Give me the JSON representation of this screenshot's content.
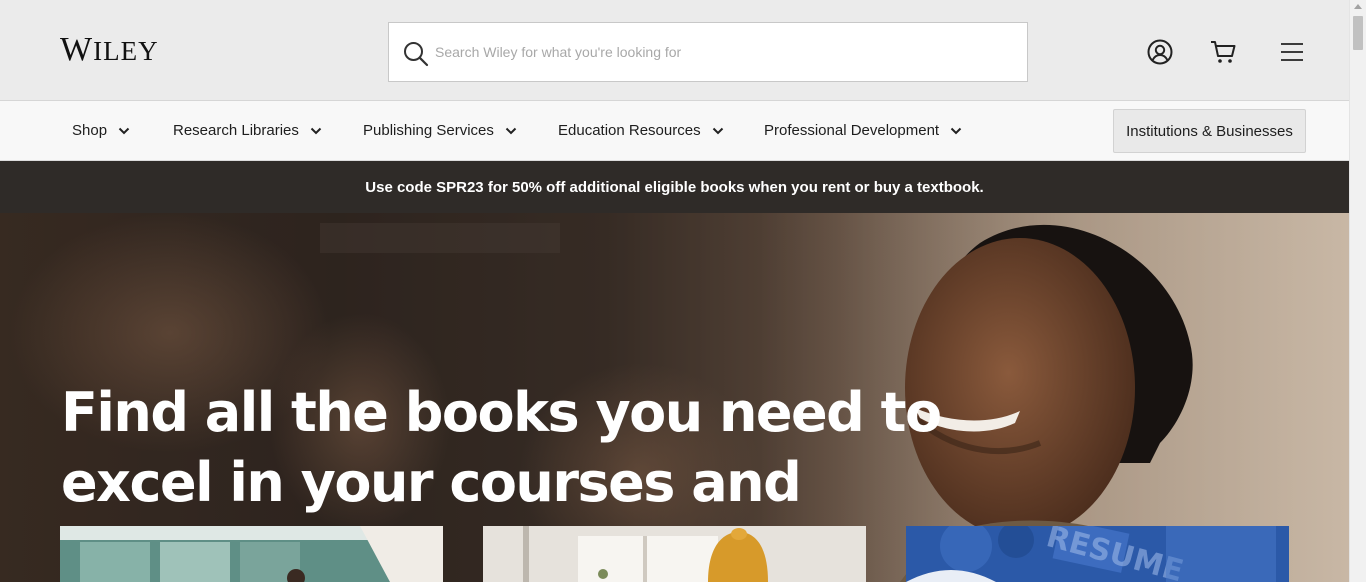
{
  "brand": {
    "logo_text": "WILEY"
  },
  "search": {
    "placeholder": "Search Wiley for what you're looking for"
  },
  "header_icons": [
    "account-icon",
    "cart-icon",
    "menu-icon"
  ],
  "nav": {
    "items": [
      {
        "label": "Shop"
      },
      {
        "label": "Research Libraries"
      },
      {
        "label": "Publishing Services"
      },
      {
        "label": "Education Resources"
      },
      {
        "label": "Professional Development"
      }
    ],
    "cta_label": "Institutions & Businesses"
  },
  "promo": {
    "text": "Use code SPR23 for 50% off additional eligible books when you rent or buy a textbook."
  },
  "hero": {
    "title_line1": "Find all the books you need to",
    "title_line2": "excel in your courses and"
  },
  "colors": {
    "header_bg": "#ebebeb",
    "nav_bg": "#f8f8f8",
    "promo_bg": "#2f2b28",
    "card3_bg": "#2b59a8"
  }
}
